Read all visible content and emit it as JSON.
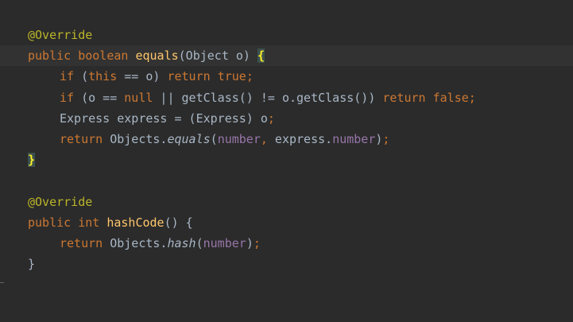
{
  "editor": {
    "lines": [
      {
        "tokens": [
          {
            "text": "@Override",
            "type": "annotation"
          }
        ]
      },
      {
        "current": true,
        "tokens": [
          {
            "text": "public",
            "type": "keyword"
          },
          {
            "text": " ",
            "type": "plain"
          },
          {
            "text": "boolean",
            "type": "keyword"
          },
          {
            "text": " ",
            "type": "plain"
          },
          {
            "text": "equals",
            "type": "method"
          },
          {
            "text": "(Object o) ",
            "type": "plain"
          },
          {
            "text": "{",
            "type": "brace-match"
          }
        ]
      },
      {
        "indent": 1,
        "tokens": [
          {
            "text": "if",
            "type": "keyword"
          },
          {
            "text": " (",
            "type": "plain"
          },
          {
            "text": "this",
            "type": "keyword"
          },
          {
            "text": " == o) ",
            "type": "plain"
          },
          {
            "text": "return",
            "type": "keyword"
          },
          {
            "text": " ",
            "type": "plain"
          },
          {
            "text": "true",
            "type": "keyword"
          },
          {
            "text": ";",
            "type": "keyword"
          }
        ]
      },
      {
        "indent": 1,
        "tokens": [
          {
            "text": "if",
            "type": "keyword"
          },
          {
            "text": " (o == ",
            "type": "plain"
          },
          {
            "text": "null",
            "type": "keyword"
          },
          {
            "text": " || getClass() != o.getClass()) ",
            "type": "plain"
          },
          {
            "text": "return",
            "type": "keyword"
          },
          {
            "text": " ",
            "type": "plain"
          },
          {
            "text": "false",
            "type": "keyword"
          },
          {
            "text": ";",
            "type": "keyword"
          }
        ]
      },
      {
        "indent": 1,
        "tokens": [
          {
            "text": "Express express = (Express) o",
            "type": "plain"
          },
          {
            "text": ";",
            "type": "keyword"
          }
        ]
      },
      {
        "indent": 1,
        "tokens": [
          {
            "text": "return",
            "type": "keyword"
          },
          {
            "text": " Objects.",
            "type": "plain"
          },
          {
            "text": "equals",
            "type": "static"
          },
          {
            "text": "(",
            "type": "plain"
          },
          {
            "text": "number",
            "type": "field"
          },
          {
            "text": ",",
            "type": "keyword"
          },
          {
            "text": " express.",
            "type": "plain"
          },
          {
            "text": "number",
            "type": "field"
          },
          {
            "text": ")",
            "type": "plain"
          },
          {
            "text": ";",
            "type": "keyword"
          }
        ]
      },
      {
        "tokens": [
          {
            "text": "}",
            "type": "brace-match"
          }
        ]
      },
      {
        "tokens": []
      },
      {
        "tokens": [
          {
            "text": "@Override",
            "type": "annotation"
          }
        ]
      },
      {
        "tokens": [
          {
            "text": "public",
            "type": "keyword"
          },
          {
            "text": " ",
            "type": "plain"
          },
          {
            "text": "int",
            "type": "keyword"
          },
          {
            "text": " ",
            "type": "plain"
          },
          {
            "text": "hashCode",
            "type": "method"
          },
          {
            "text": "() {",
            "type": "plain"
          }
        ]
      },
      {
        "indent": 1,
        "tokens": [
          {
            "text": "return",
            "type": "keyword"
          },
          {
            "text": " Objects.",
            "type": "plain"
          },
          {
            "text": "hash",
            "type": "static"
          },
          {
            "text": "(",
            "type": "plain"
          },
          {
            "text": "number",
            "type": "field"
          },
          {
            "text": ")",
            "type": "plain"
          },
          {
            "text": ";",
            "type": "keyword"
          }
        ]
      },
      {
        "tokens": [
          {
            "text": "}",
            "type": "plain"
          }
        ]
      }
    ]
  },
  "colors": {
    "background": "#2b2b2b",
    "current_line": "#323232",
    "keyword": "#cc7832",
    "annotation": "#bbb529",
    "method_declaration": "#ffc66d",
    "field": "#9876aa",
    "plain": "#a9b7c6",
    "brace_match_text": "#ffef28",
    "brace_match_background": "#3b514d"
  }
}
